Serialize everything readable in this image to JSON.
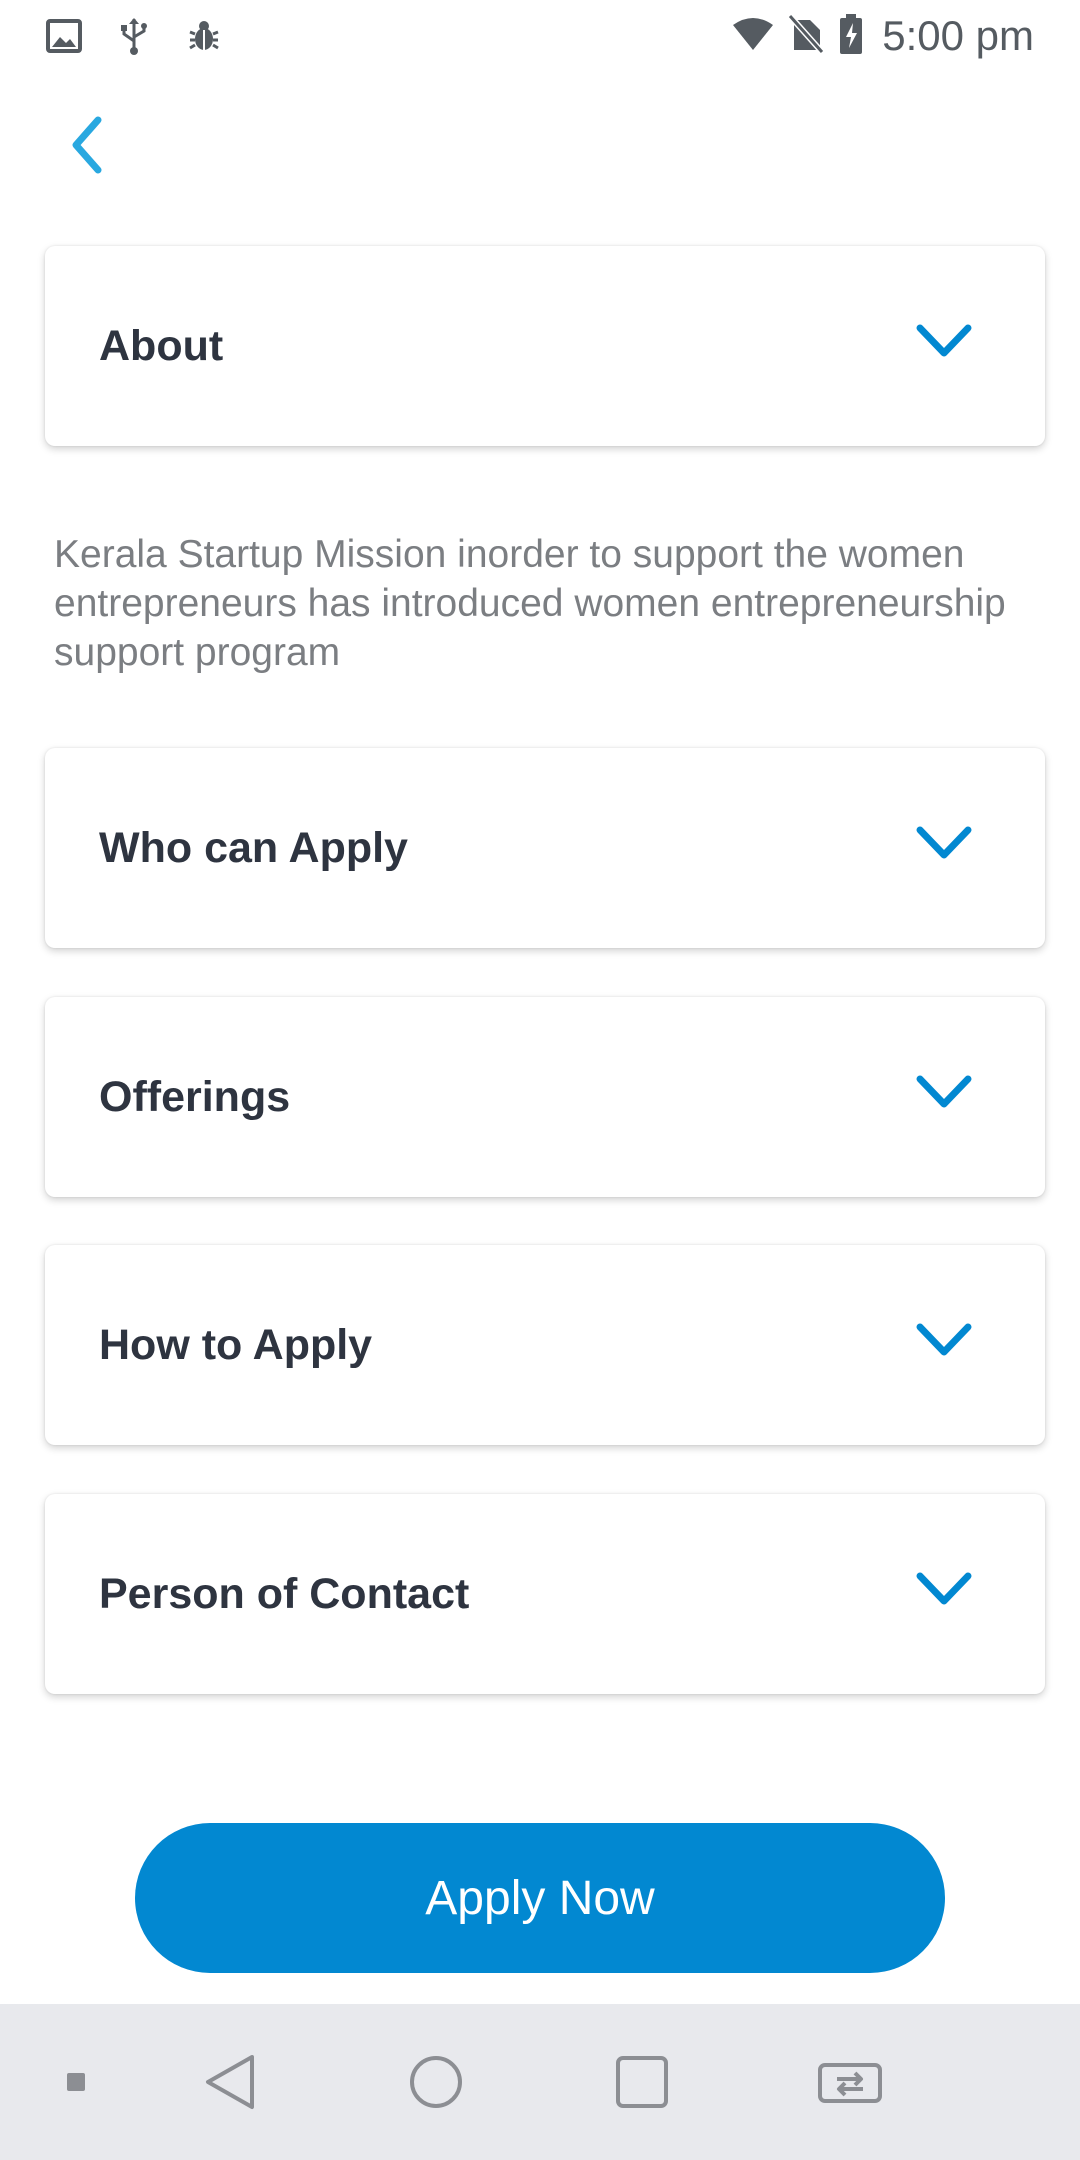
{
  "status_bar": {
    "time": "5:00 pm",
    "left_icons": [
      "image-icon",
      "usb-icon",
      "bug-icon"
    ],
    "right_icons": [
      "wifi-icon",
      "no-sim-icon",
      "battery-charging-icon"
    ]
  },
  "header": {
    "back_icon": "chevron-left-icon"
  },
  "sections": {
    "about": {
      "title": "About",
      "description": "Kerala Startup Mission inorder to support the women entrepreneurs has introduced women entrepreneurship support program"
    },
    "who_can_apply": {
      "title": "Who can Apply"
    },
    "offerings": {
      "title": "Offerings"
    },
    "how_to_apply": {
      "title": "How to Apply"
    },
    "person_of_contact": {
      "title": "Person of Contact"
    }
  },
  "cta": {
    "label": "Apply Now"
  },
  "nav_bar": {
    "icons": [
      "square-dot-icon",
      "back-triangle-icon",
      "home-circle-icon",
      "recents-square-icon",
      "screen-switch-icon"
    ]
  },
  "colors": {
    "accent": "#0288d1",
    "back_arrow": "#29a8e0",
    "title_text": "#2e3440",
    "body_text": "#7b7e82"
  }
}
